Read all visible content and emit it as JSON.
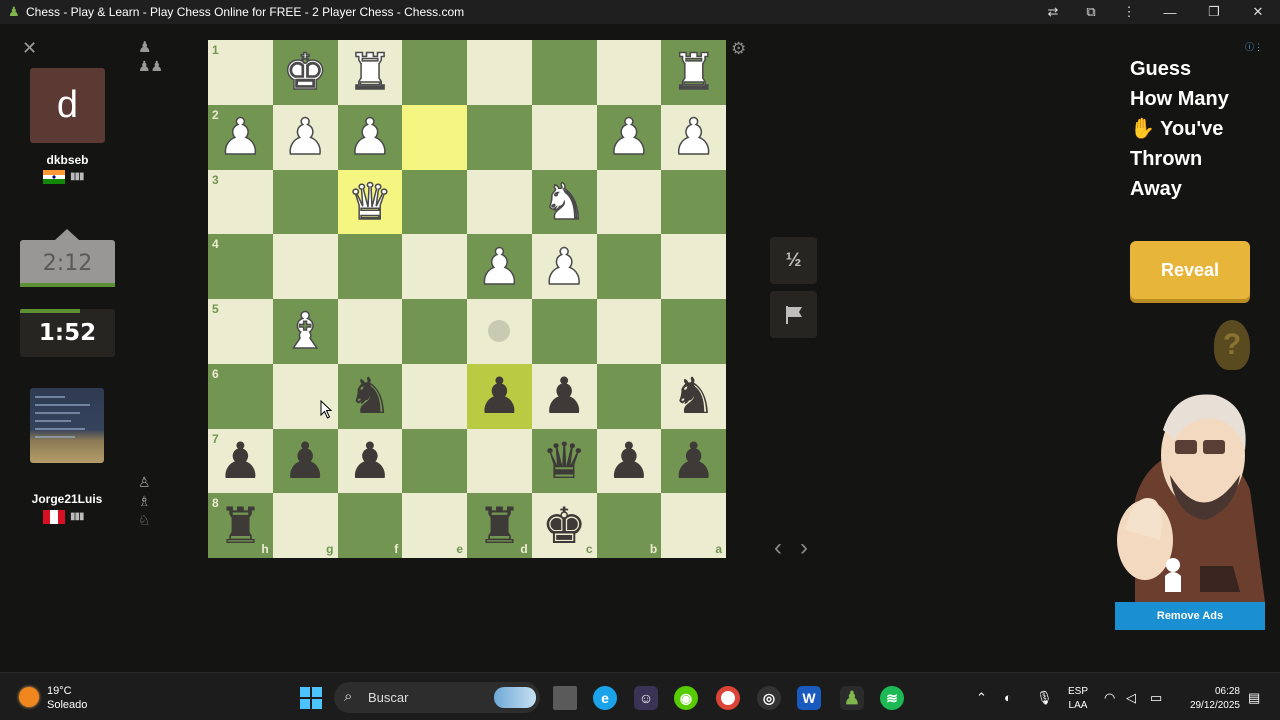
{
  "window": {
    "title": "Chess - Play & Learn - Play Chess Online for FREE - 2 Player Chess - Chess.com"
  },
  "opponent": {
    "avatar_letter": "d",
    "name": "dkbseb",
    "clock": "2:12",
    "strength_bars": "▮▮▮"
  },
  "player": {
    "name": "Jorge21Luis",
    "clock": "1:52",
    "strength_bars": "▮▮▮"
  },
  "board": {
    "ranks": [
      "1",
      "2",
      "3",
      "4",
      "5",
      "6",
      "7",
      "8"
    ],
    "files": [
      "h",
      "g",
      "f",
      "e",
      "d",
      "c",
      "b",
      "a"
    ],
    "rows": [
      [
        "",
        "wK",
        "wR",
        "",
        "",
        "",
        "",
        "wR"
      ],
      [
        "wP",
        "wP",
        "wP",
        "",
        "",
        "",
        "wP",
        "wP"
      ],
      [
        "",
        "",
        "wQ",
        "",
        "",
        "wN",
        "",
        ""
      ],
      [
        "",
        "",
        "",
        "",
        "wP",
        "wP",
        "",
        ""
      ],
      [
        "",
        "wB",
        "",
        "",
        "dot",
        "",
        "",
        ""
      ],
      [
        "",
        "",
        "bN",
        "",
        "bP",
        "bP",
        "",
        "bN"
      ],
      [
        "bP",
        "bP",
        "bP",
        "",
        "",
        "bQ",
        "bP",
        "bP"
      ],
      [
        "bR",
        "",
        "",
        "",
        "bR",
        "bK",
        "",
        ""
      ]
    ],
    "highlighted": [
      "1-3",
      "2-2",
      "5-4"
    ]
  },
  "controls": {
    "draw_label": "½",
    "resign_icon": "flag-icon"
  },
  "ad": {
    "lines": [
      "Guess",
      "How Many",
      "✋ You've",
      "Thrown",
      "Away"
    ],
    "button_label": "Reveal",
    "remove_label": "Remove Ads",
    "hint_glyph": "?"
  },
  "taskbar": {
    "temperature": "19°C",
    "condition": "Soleado",
    "search_placeholder": "Buscar",
    "lang_line1": "ESP",
    "lang_line2": "LAA",
    "time": "06:28",
    "date": "29/12/2025"
  }
}
